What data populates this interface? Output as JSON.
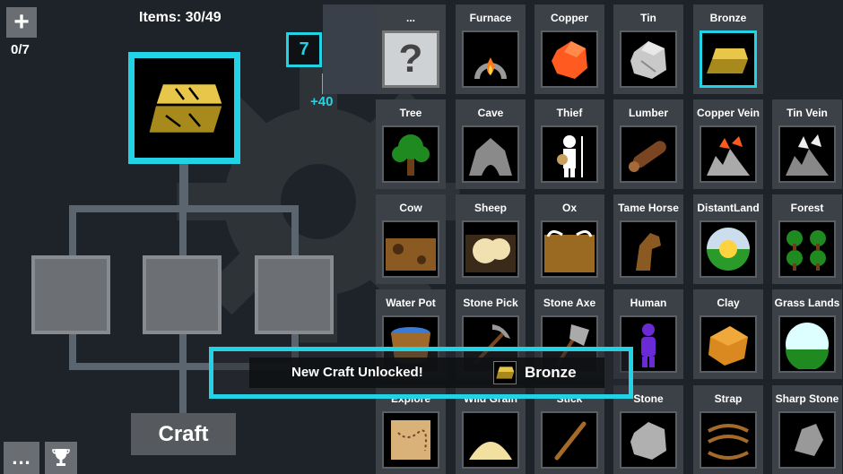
{
  "hud": {
    "add_label": "+",
    "counter": "0/7",
    "items_count": "Items: 30/49",
    "badge_value": "7",
    "bonus": "+40",
    "craft_label": "Craft",
    "more_label": "...",
    "trophy_icon": "trophy-icon"
  },
  "recipe": {
    "result_icon": "bronze-ingot-icon"
  },
  "colors": {
    "accent": "#22d3e6",
    "background": "#1e2329",
    "tile": "#3c4148"
  },
  "grid": {
    "rows": [
      [
        {
          "label": "...",
          "icon": "unknown-icon",
          "unknown": true
        },
        {
          "label": "Furnace",
          "icon": "furnace-icon"
        },
        {
          "label": "Copper",
          "icon": "copper-icon"
        },
        {
          "label": "Tin",
          "icon": "tin-icon"
        },
        {
          "label": "Bronze",
          "icon": "bronze-icon",
          "selected": true
        }
      ],
      [
        {
          "label": "Tree",
          "icon": "tree-icon"
        },
        {
          "label": "Cave",
          "icon": "cave-icon"
        },
        {
          "label": "Thief",
          "icon": "thief-icon"
        },
        {
          "label": "Lumber",
          "icon": "lumber-icon"
        },
        {
          "label": "Copper Vein",
          "icon": "copper-vein-icon"
        },
        {
          "label": "Tin Vein",
          "icon": "tin-vein-icon"
        }
      ],
      [
        {
          "label": "Cow",
          "icon": "cow-icon"
        },
        {
          "label": "Sheep",
          "icon": "sheep-icon"
        },
        {
          "label": "Ox",
          "icon": "ox-icon"
        },
        {
          "label": "Tame Horse",
          "icon": "horse-icon"
        },
        {
          "label": "DistantLand",
          "icon": "distant-land-icon"
        },
        {
          "label": "Forest",
          "icon": "forest-icon"
        }
      ],
      [
        {
          "label": "Water Pot",
          "icon": "water-pot-icon"
        },
        {
          "label": "Stone Pick",
          "icon": "stone-pick-icon"
        },
        {
          "label": "Stone Axe",
          "icon": "stone-axe-icon"
        },
        {
          "label": "Human",
          "icon": "human-icon"
        },
        {
          "label": "Clay",
          "icon": "clay-icon"
        },
        {
          "label": "Grass Lands",
          "icon": "grass-lands-icon"
        }
      ],
      [
        {
          "label": "Explore",
          "icon": "map-icon"
        },
        {
          "label": "Wild Grain",
          "icon": "grain-icon"
        },
        {
          "label": "Stick",
          "icon": "stick-icon"
        },
        {
          "label": "Stone",
          "icon": "stone-icon"
        },
        {
          "label": "Strap",
          "icon": "strap-icon"
        },
        {
          "label": "Sharp Stone",
          "icon": "sharp-stone-icon"
        }
      ]
    ]
  },
  "notification": {
    "message": "New Craft Unlocked!",
    "item_name": "Bronze",
    "item_icon": "bronze-icon"
  }
}
